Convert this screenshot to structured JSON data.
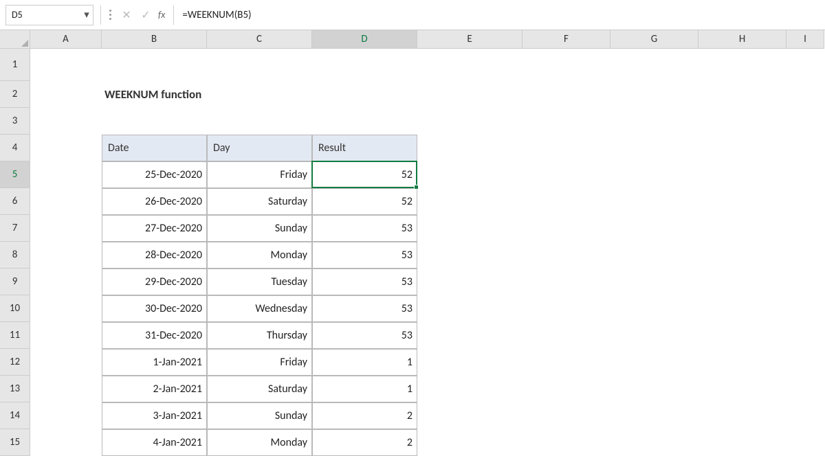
{
  "formula_bar": {
    "name_box": "D5",
    "formula": "=WEEKNUM(B5)",
    "fx_label": "fx",
    "cancel_icon": "✕",
    "enter_icon": "✓",
    "dropdown_icon": "▾"
  },
  "columns": [
    "A",
    "B",
    "C",
    "D",
    "E",
    "F",
    "G",
    "H",
    "I"
  ],
  "rows": [
    "1",
    "2",
    "3",
    "4",
    "5",
    "6",
    "7",
    "8",
    "9",
    "10",
    "11",
    "12",
    "13",
    "14",
    "15"
  ],
  "active_col": "D",
  "active_row": "5",
  "content": {
    "title": "WEEKNUM function",
    "headers": {
      "date": "Date",
      "day": "Day",
      "result": "Result"
    },
    "data": [
      {
        "date": "25-Dec-2020",
        "day": "Friday",
        "result": "52"
      },
      {
        "date": "26-Dec-2020",
        "day": "Saturday",
        "result": "52"
      },
      {
        "date": "27-Dec-2020",
        "day": "Sunday",
        "result": "53"
      },
      {
        "date": "28-Dec-2020",
        "day": "Monday",
        "result": "53"
      },
      {
        "date": "29-Dec-2020",
        "day": "Tuesday",
        "result": "53"
      },
      {
        "date": "30-Dec-2020",
        "day": "Wednesday",
        "result": "53"
      },
      {
        "date": "31-Dec-2020",
        "day": "Thursday",
        "result": "53"
      },
      {
        "date": "1-Jan-2021",
        "day": "Friday",
        "result": "1"
      },
      {
        "date": "2-Jan-2021",
        "day": "Saturday",
        "result": "1"
      },
      {
        "date": "3-Jan-2021",
        "day": "Sunday",
        "result": "2"
      },
      {
        "date": "4-Jan-2021",
        "day": "Monday",
        "result": "2"
      }
    ]
  }
}
